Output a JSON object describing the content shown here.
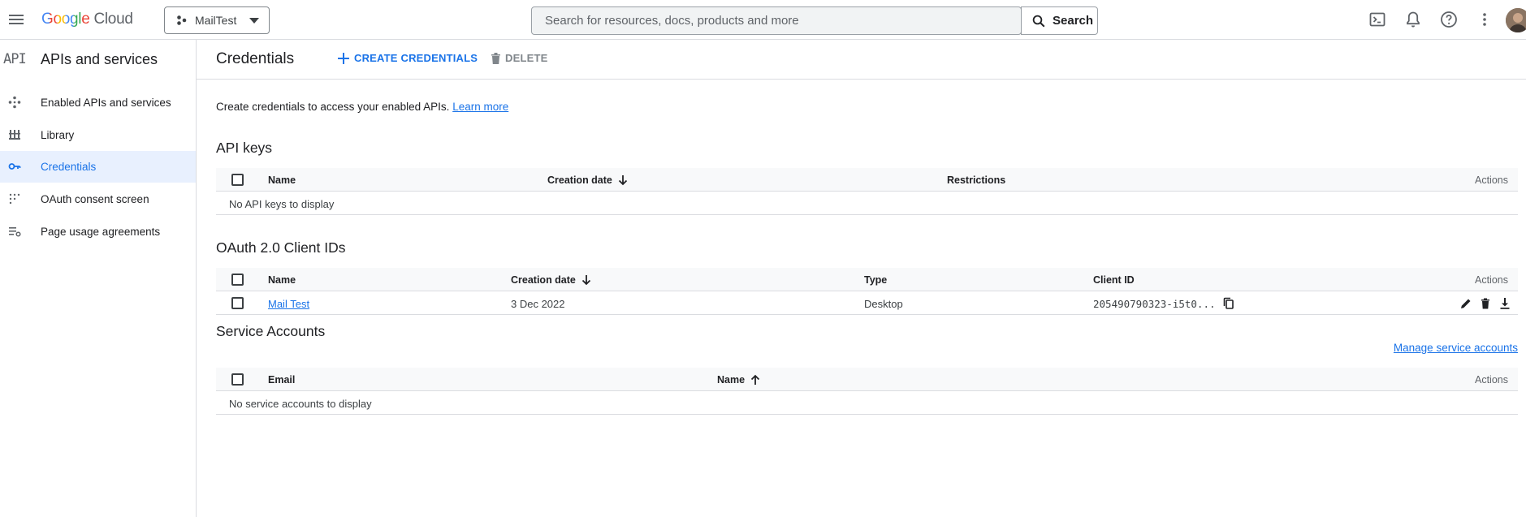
{
  "topbar": {
    "logo_google": "Google",
    "logo_cloud": "Cloud",
    "project": "MailTest",
    "search_placeholder": "Search for resources, docs, products and more",
    "search_button": "Search"
  },
  "sidebar": {
    "badge": "API",
    "title": "APIs and services",
    "items": [
      {
        "label": "Enabled APIs and services",
        "icon": "move-icon"
      },
      {
        "label": "Library",
        "icon": "library-icon"
      },
      {
        "label": "Credentials",
        "icon": "key-icon",
        "active": true
      },
      {
        "label": "OAuth consent screen",
        "icon": "consent-icon"
      },
      {
        "label": "Page usage agreements",
        "icon": "agreements-icon"
      }
    ]
  },
  "main": {
    "title": "Credentials",
    "create_label": "CREATE CREDENTIALS",
    "delete_label": "DELETE",
    "intro_text": "Create credentials to access your enabled APIs.",
    "learn_more": "Learn more"
  },
  "api_keys": {
    "title": "API keys",
    "columns": [
      "Name",
      "Creation date",
      "Restrictions",
      "Actions"
    ],
    "empty": "No API keys to display"
  },
  "oauth": {
    "title": "OAuth 2.0 Client IDs",
    "columns": [
      "Name",
      "Creation date",
      "Type",
      "Client ID",
      "Actions"
    ],
    "rows": [
      {
        "name": "Mail Test",
        "created": "3 Dec 2022",
        "type": "Desktop",
        "client_id": "205490790323-i5t0..."
      }
    ]
  },
  "service_accounts": {
    "title": "Service Accounts",
    "manage_link": "Manage service accounts",
    "columns": [
      "Email",
      "Name",
      "Actions"
    ],
    "empty": "No service accounts to display"
  },
  "colors": {
    "accent": "#1a73e8",
    "active_bg": "#e8f0fe",
    "border": "#dadce0"
  }
}
